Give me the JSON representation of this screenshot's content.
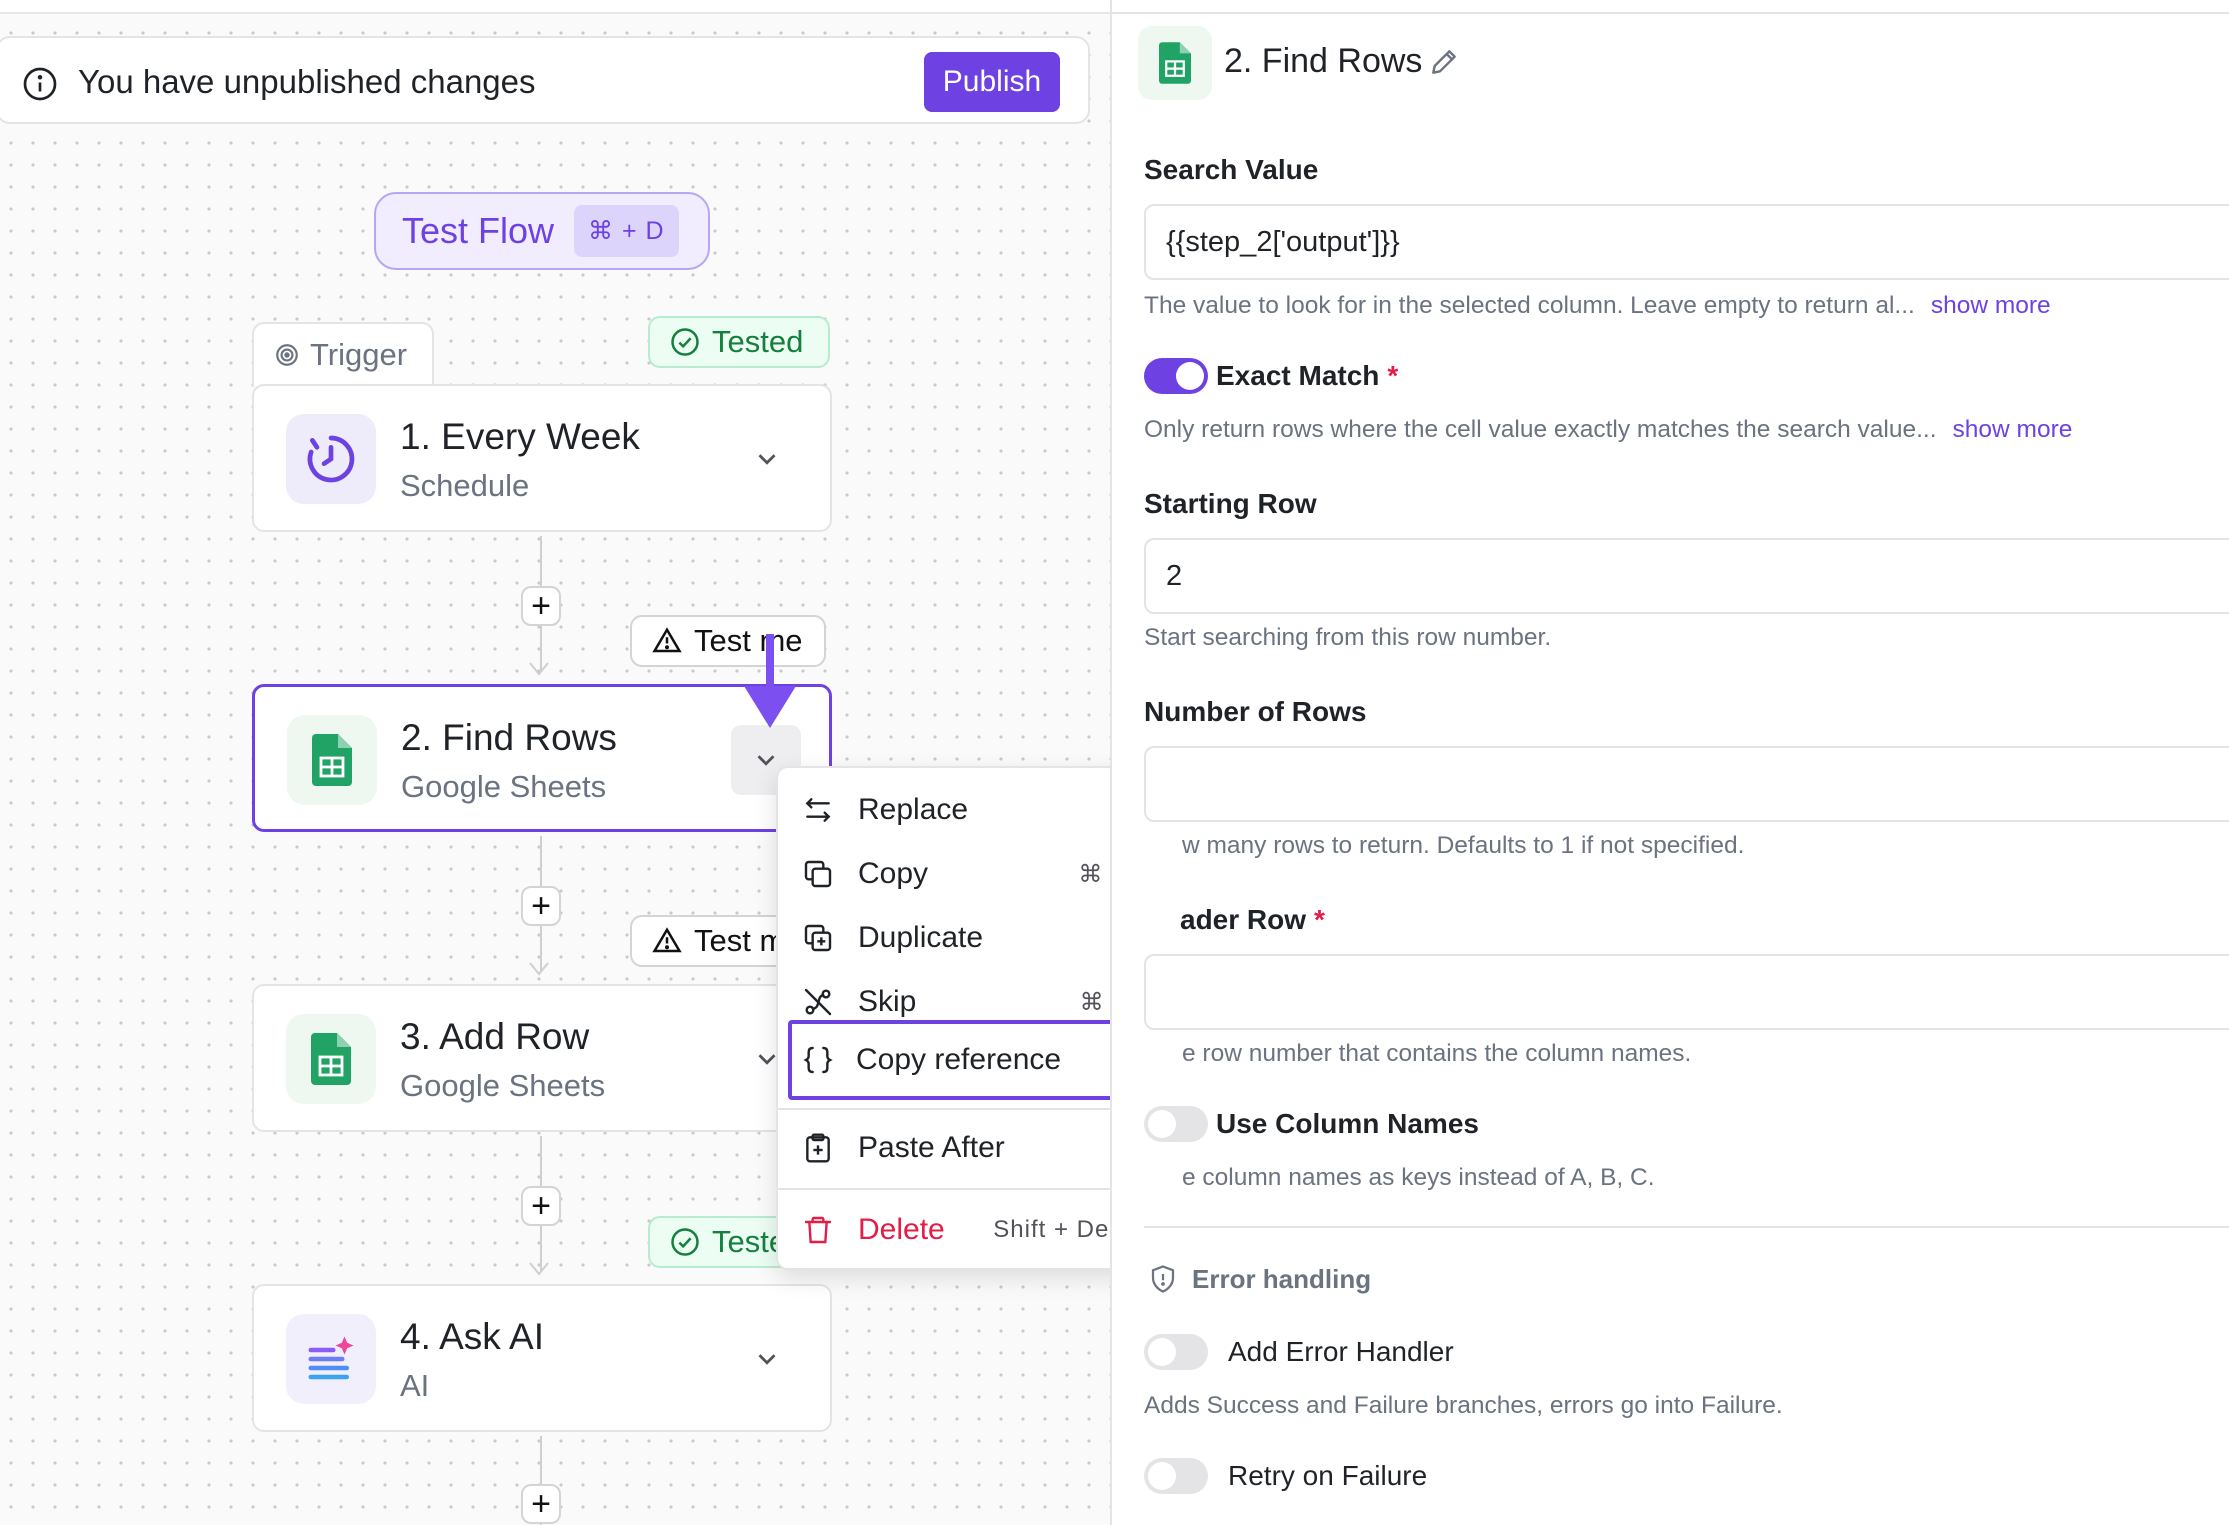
{
  "banner": {
    "message": "You have unpublished changes",
    "publish_label": "Publish"
  },
  "test_flow": {
    "label": "Test Flow",
    "shortcut": "⌘ + D"
  },
  "trigger_tab": {
    "label": "Trigger"
  },
  "badges": {
    "tested_1": "Tested",
    "test_me_1": "Test me",
    "test_me_2": "Test me",
    "tested_2": "Tested"
  },
  "steps": [
    {
      "title": "1. Every Week",
      "subtitle": "Schedule",
      "icon": "schedule-icon"
    },
    {
      "title": "2. Find Rows",
      "subtitle": "Google Sheets",
      "icon": "google-sheets-icon"
    },
    {
      "title": "3. Add Row",
      "subtitle": "Google Sheets",
      "icon": "google-sheets-icon"
    },
    {
      "title": "4. Ask AI",
      "subtitle": "AI",
      "icon": "ai-icon"
    }
  ],
  "add_button_label": "+",
  "context_menu": {
    "items": [
      {
        "label": "Replace",
        "icon": "replace-icon",
        "shortcut": ""
      },
      {
        "label": "Copy",
        "icon": "copy-icon",
        "shortcut": "⌘ + C"
      },
      {
        "label": "Duplicate",
        "icon": "duplicate-icon",
        "shortcut": ""
      },
      {
        "label": "Skip",
        "icon": "skip-icon",
        "shortcut": "⌘ + E"
      },
      {
        "label": "Copy reference",
        "icon": "braces-icon",
        "shortcut": ""
      },
      {
        "label": "Paste After",
        "icon": "paste-icon",
        "shortcut": ""
      },
      {
        "label": "Delete",
        "icon": "trash-icon",
        "shortcut": "Shift + Delete"
      }
    ],
    "highlighted": "Copy reference"
  },
  "panel": {
    "title": "2. Find Rows",
    "search_value": {
      "label": "Search Value",
      "value": "{{step_2['output']}}",
      "help": "The value to look for in the selected column. Leave empty to return al...",
      "more": "show more"
    },
    "exact_match": {
      "label": "Exact Match",
      "required": "*",
      "enabled": true,
      "help": "Only return rows where the cell value exactly matches the search value...",
      "more": "show more"
    },
    "starting_row": {
      "label": "Starting Row",
      "value": "2",
      "help": "Start searching from this row number."
    },
    "number_of_rows": {
      "label": "Number of Rows",
      "value": "",
      "help_visible": "w many rows to return. Defaults to 1 if not specified."
    },
    "header_row": {
      "label_visible": "ader Row",
      "required": "*",
      "value": "",
      "help_visible": "e row number that contains the column names."
    },
    "use_column_names": {
      "label": "Use Column Names",
      "help_visible": "e column names as keys instead of A, B, C."
    },
    "error_handling": {
      "title": "Error handling",
      "add_error_handler": {
        "label": "Add Error Handler",
        "enabled": false,
        "help": "Adds Success and Failure branches, errors go into Failure."
      },
      "retry_on_failure": {
        "label": "Retry on Failure",
        "enabled": false
      }
    }
  },
  "colors": {
    "accent": "#6e41e2",
    "success": "#15803d",
    "danger": "#e11d48",
    "sheets_green": "#21a366"
  }
}
